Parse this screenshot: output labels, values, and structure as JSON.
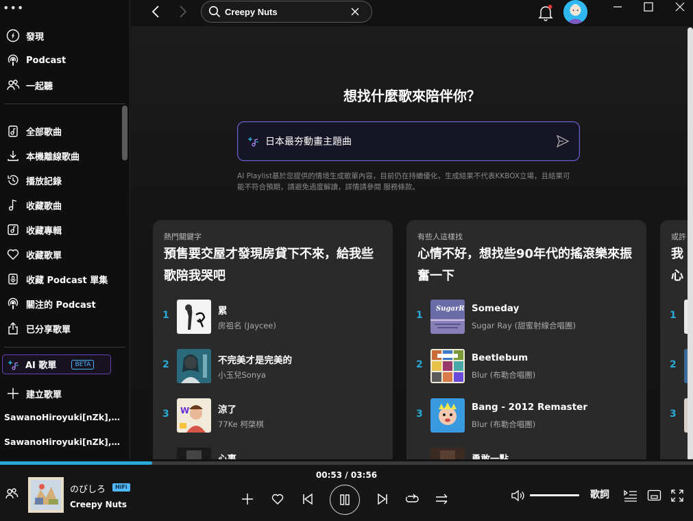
{
  "sidebar": {
    "menu_glyph": "•••",
    "primary": [
      {
        "label": "發現",
        "icon": "compass-icon"
      },
      {
        "label": "Podcast",
        "icon": "podcast-icon"
      },
      {
        "label": "一起聽",
        "icon": "listen-together-icon"
      }
    ],
    "library": [
      {
        "label": "全部歌曲",
        "icon": "all-songs-icon"
      },
      {
        "label": "本機離線歌曲",
        "icon": "download-icon"
      },
      {
        "label": "播放記錄",
        "icon": "history-icon"
      },
      {
        "label": "收藏歌曲",
        "icon": "music-note-icon"
      },
      {
        "label": "收藏專輯",
        "icon": "album-icon"
      },
      {
        "label": "收藏歌單",
        "icon": "heart-icon"
      },
      {
        "label": "收藏 Podcast 單集",
        "icon": "mic-icon"
      },
      {
        "label": "關注的 Podcast",
        "icon": "podcast-follow-icon"
      },
      {
        "label": "已分享歌單",
        "icon": "share-icon"
      }
    ],
    "ai_playlist": {
      "label": "AI 歌單",
      "badge": "BETA"
    },
    "create_playlist": "建立歌單",
    "playlists": [
      "SawanoHiroyuki[nZk],…",
      "SawanoHiroyuki[nZk],…"
    ]
  },
  "topbar": {
    "search_value": "Creepy Nuts"
  },
  "main": {
    "headline": "想找什麼歌來陪伴你？",
    "ai_prompt": "日本最夯動畫主題曲",
    "disclaimer": "AI Playlist基於您提供的情境生成歌單內容，目前仍在持續優化，生成結果不代表KKBOX立場，且結果可能不符合預期，請避免過度解讀，詳情請參閱 服務條款。",
    "cards": [
      {
        "kicker": "熱門關鍵字",
        "title": "預售要交屋才發現房貸下不來，給我些歌陪我哭吧",
        "songs": [
          {
            "rank": "1",
            "title": "累",
            "artist": "房祖名 (Jaycee)"
          },
          {
            "rank": "2",
            "title": "不完美才是完美的",
            "artist": "小玉兒Sonya"
          },
          {
            "rank": "3",
            "title": "涼了",
            "artist": "77Ke 柯棨棋"
          },
          {
            "rank": "",
            "title": "心事",
            "artist": ""
          }
        ]
      },
      {
        "kicker": "有些人這樣找",
        "title": "心情不好，想找些90年代的搖滾樂來振奮一下",
        "songs": [
          {
            "rank": "1",
            "title": "Someday",
            "artist": "Sugar Ray (甜蜜射線合唱團)"
          },
          {
            "rank": "2",
            "title": "Beetlebum",
            "artist": "Blur (布勒合唱團)"
          },
          {
            "rank": "3",
            "title": "Bang - 2012 Remaster",
            "artist": "Blur (布勒合唱團)"
          },
          {
            "rank": "",
            "title": "勇敢一點",
            "artist": ""
          }
        ]
      },
      {
        "kicker": "或許",
        "title": "我心",
        "songs": [
          {
            "rank": "1",
            "title": "",
            "artist": ""
          },
          {
            "rank": "2",
            "title": "",
            "artist": ""
          },
          {
            "rank": "3",
            "title": "",
            "artist": ""
          }
        ]
      }
    ]
  },
  "player": {
    "track": "のびしろ",
    "quality_badge": "HiFi",
    "artist": "Creepy Nuts",
    "time": "00:53 / 03:56",
    "progress_fraction": 0.22,
    "volume_fraction": 1.0,
    "lyrics_label": "歌詞"
  },
  "colors": {
    "accent": "#29a9d6",
    "ai_border": "#7a5bd6",
    "card_bg": "#2a2a2a",
    "background": "#121212"
  }
}
